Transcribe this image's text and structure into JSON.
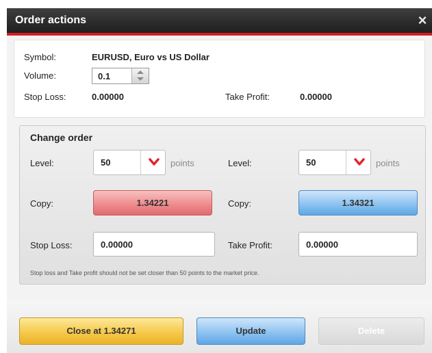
{
  "window": {
    "title": "Order actions",
    "close_symbol": "×"
  },
  "info": {
    "symbol_label": "Symbol:",
    "symbol_value": "EURUSD, Euro vs US Dollar",
    "volume_label": "Volume:",
    "volume_value": "0.1",
    "stop_loss_label": "Stop Loss:",
    "stop_loss_value": "0.00000",
    "take_profit_label": "Take Profit:",
    "take_profit_value": "0.00000"
  },
  "change_order": {
    "title": "Change order",
    "left": {
      "level_label": "Level:",
      "level_value": "50",
      "unit": "points",
      "copy_label": "Copy:",
      "copy_value": "1.34221",
      "field_label": "Stop Loss:",
      "field_value": "0.00000"
    },
    "right": {
      "level_label": "Level:",
      "level_value": "50",
      "unit": "points",
      "copy_label": "Copy:",
      "copy_value": "1.34321",
      "field_label": "Take Profit:",
      "field_value": "0.00000"
    },
    "note": "Stop loss and Take profit should not be set closer than 50 points to the market price."
  },
  "footer": {
    "close_label": "Close at 1.34271",
    "update_label": "Update",
    "delete_label": "Delete"
  },
  "colors": {
    "title_accent": "#d21f24",
    "sell_button": "#ee8d8f",
    "buy_button": "#8ec3f0",
    "close_button": "#f6c94b",
    "dropdown_arrow": "#e0262b"
  }
}
